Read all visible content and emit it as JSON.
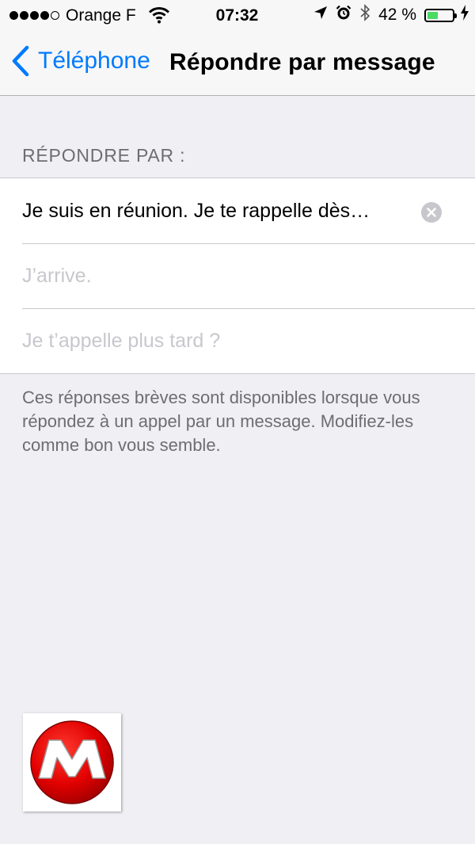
{
  "status_bar": {
    "carrier": "Orange F",
    "time": "07:32",
    "battery_percent": "42 %",
    "battery_level": 0.42,
    "signal_bars": 4,
    "signal_total": 5
  },
  "nav": {
    "back_label": "Téléphone",
    "title": "Répondre par message"
  },
  "section": {
    "header": "RÉPONDRE PAR :",
    "responses": [
      {
        "text": "Je suis en réunion. Je te rappelle dès…",
        "is_placeholder": false
      },
      {
        "text": "J’arrive.",
        "is_placeholder": true
      },
      {
        "text": "Je t’appelle plus tard ?",
        "is_placeholder": true
      }
    ],
    "footer": "Ces réponses brèves sont disponibles lorsque vous répondez à un appel par un message. Modifiez-les comme bon vous semble."
  },
  "colors": {
    "accent": "#007aff",
    "battery": "#4cd964",
    "logo_red": "#e10000"
  },
  "icons": [
    "wifi-icon",
    "location-arrow-icon",
    "alarm-icon",
    "bluetooth-icon",
    "battery-icon",
    "charging-bolt-icon",
    "chevron-left-icon",
    "clear-icon",
    "m-logo-icon"
  ]
}
